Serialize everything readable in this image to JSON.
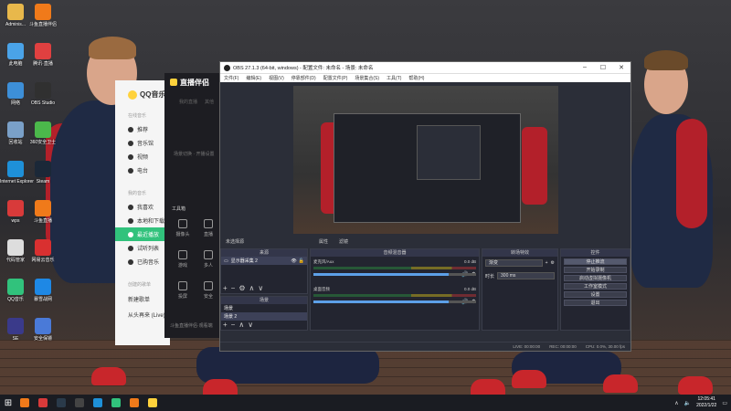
{
  "desktop_icons": [
    {
      "label": "Adminis...",
      "icon": "folder-user-icon",
      "color": "#e8b84b"
    },
    {
      "label": "斗鱼直播伴侣",
      "icon": "douyu-icon",
      "color": "#f07a1a"
    },
    {
      "label": "此电脑",
      "icon": "computer-icon",
      "color": "#4aa3e8"
    },
    {
      "label": "腾讯·直播",
      "icon": "live-icon",
      "color": "#e04040"
    },
    {
      "label": "网络",
      "icon": "network-icon",
      "color": "#3d8fd8"
    },
    {
      "label": "OBS Studio",
      "icon": "obs-icon",
      "color": "#303030"
    },
    {
      "label": "回收站",
      "icon": "recycle-bin-icon",
      "color": "#7aa0c8"
    },
    {
      "label": "360安全卫士",
      "icon": "shield-360-icon",
      "color": "#4bb84b"
    },
    {
      "label": "Internet Explorer",
      "icon": "ie-icon",
      "color": "#1e90d8"
    },
    {
      "label": "Steam",
      "icon": "steam-icon",
      "color": "#1b2838"
    },
    {
      "label": "wps",
      "icon": "wps-icon",
      "color": "#d83a3a"
    },
    {
      "label": "斗鱼直播",
      "icon": "douyu-live-icon",
      "color": "#f07a1a"
    },
    {
      "label": "代码管家",
      "icon": "document-icon",
      "color": "#dddddd"
    },
    {
      "label": "网易云音乐",
      "icon": "netease-music-icon",
      "color": "#d93030"
    },
    {
      "label": "QQ音乐",
      "icon": "qq-music-icon",
      "color": "#31c27c"
    },
    {
      "label": "暴雪战网",
      "icon": "battlenet-icon",
      "color": "#1e88e5"
    },
    {
      "label": "SE",
      "icon": "se-icon",
      "color": "#3a3a8a"
    },
    {
      "label": "安全保镖",
      "icon": "guard-icon",
      "color": "#4a7ad8"
    }
  ],
  "qq_music": {
    "app_name": "QQ音乐",
    "section_online": "在线音乐",
    "nav": [
      {
        "label": "推荐",
        "active": false
      },
      {
        "label": "音乐馆",
        "active": false
      },
      {
        "label": "视频",
        "active": false
      },
      {
        "label": "电台",
        "active": false
      }
    ],
    "section_mine": "我的音乐",
    "mine": [
      {
        "label": "我喜欢",
        "active": false
      },
      {
        "label": "本地和下载",
        "active": false
      },
      {
        "label": "最近播放",
        "active": true
      },
      {
        "label": "试听列表",
        "active": false
      },
      {
        "label": "已购音乐",
        "active": false
      }
    ],
    "section_created": "创建的歌单",
    "created": [
      "新建歌单",
      "从头再来 (Live)"
    ]
  },
  "live_companion": {
    "title": "直播伴侣",
    "tabs": [
      "我的直播",
      "其他"
    ],
    "hint": "场景切换 · 开播设置",
    "toolbox_label": "工具箱",
    "tools": [
      "摄像头",
      "直播",
      "游戏",
      "多人",
      "投屏",
      "安全"
    ],
    "footer": "斗鱼直播伴侣·观看端"
  },
  "obs": {
    "title": "OBS 27.1.3 (64-bit, windows) - 配置文件: 未命名 - 场景: 未命名",
    "menu": [
      "文件(F)",
      "编辑(E)",
      "视图(V)",
      "停靠部件(D)",
      "配置文件(P)",
      "场景集合(S)",
      "工具(T)",
      "帮助(H)"
    ],
    "scene_label": "未选择源",
    "scene_tabs": [
      "属性",
      "滤镜"
    ],
    "docks": {
      "sources_title": "来源",
      "sources": [
        {
          "label": "显示器采集 2",
          "selected": true
        }
      ],
      "scenes_title": "场景",
      "scenes": [
        {
          "label": "场景",
          "selected": false
        },
        {
          "label": "场景 2",
          "selected": true
        }
      ],
      "mixer_title": "音频混音器",
      "mixer": [
        {
          "name": "麦克风/Aux",
          "db": "0.0 dB",
          "level": 0.98
        },
        {
          "name": "桌面音频",
          "db": "0.0 dB",
          "level": 0.98
        }
      ],
      "transitions_title": "转场特效",
      "transition": "渐变",
      "duration_label": "时长",
      "duration": "300 ms",
      "controls_title": "控件",
      "controls": [
        "停止推流",
        "开始录制",
        "启动虚拟摄像机",
        "工作室模式",
        "设置",
        "退出"
      ]
    },
    "status": {
      "live": "LIVE: 00:00:00",
      "rec": "REC: 00:00:00",
      "cpu": "CPU: 0.0%, 30.00 fps"
    }
  },
  "taskbar": {
    "apps": [
      {
        "icon": "douyu-icon",
        "color": "#f07a1a"
      },
      {
        "icon": "video-icon",
        "color": "#d83a3a"
      },
      {
        "icon": "steam-icon",
        "color": "#2a3a4a"
      },
      {
        "icon": "obs-icon",
        "color": "#444444"
      },
      {
        "icon": "ie-icon",
        "color": "#1e90d8"
      },
      {
        "icon": "qq-music-icon",
        "color": "#31c27c"
      },
      {
        "icon": "douyu-live-icon",
        "color": "#f07a1a"
      },
      {
        "icon": "live-companion-icon",
        "color": "#ffd23c"
      }
    ],
    "time": "12:05:41",
    "date": "2022/1/22"
  }
}
